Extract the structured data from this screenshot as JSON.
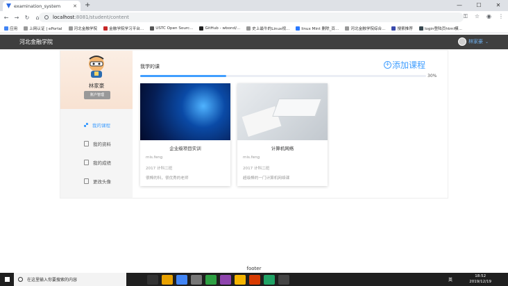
{
  "browser": {
    "tab_title": "examination_system",
    "address_host": "localhost",
    "address_path": ":8081/student/content",
    "bookmarks": [
      "应用",
      "上网认证 | ePortal",
      "河北金融学院",
      "金融学院学习平台...",
      "USTC Open Sourc...",
      "GitHub - wbond/...",
      "史上最牛的Linux视...",
      "linux Mint 删除_百...",
      "河北金融学院综合...",
      "搜索推荐",
      "login登陆页html模..."
    ]
  },
  "app": {
    "brand": "河北金融学院",
    "user_name": "林家豪"
  },
  "sidebar": {
    "name": "林家豪",
    "account_button": "账户管理",
    "menu": [
      "我的课程",
      "我的资料",
      "我的成绩",
      "更改头像"
    ]
  },
  "main": {
    "title": "我学的课",
    "add_course": "添加课程",
    "progress_label": "30%",
    "progress_value": 0.3
  },
  "courses": [
    {
      "title": "企业级项目实训",
      "teacher": "mis.feng",
      "class": "2017 计科二班",
      "desc": "很棒的科，很优秀的老师"
    },
    {
      "title": "计算机网络",
      "teacher": "mis.feng",
      "class": "2017 计科二班",
      "desc": "超级棒的一门计算机网络课"
    }
  ],
  "footer": "footer",
  "taskbar": {
    "search_placeholder": "在这里输入你要搜索的内容",
    "time": "18:52",
    "date": "2019/12/19",
    "ime": "英"
  }
}
